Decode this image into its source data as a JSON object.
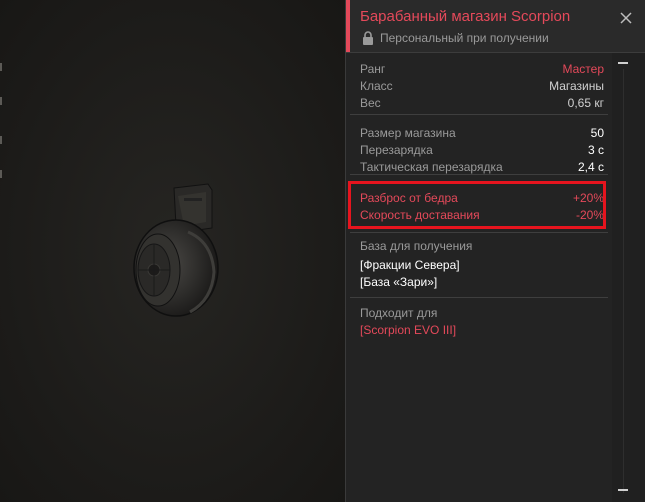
{
  "item": {
    "title": "Барабанный магазин Scorpion",
    "subtitle": "Персональный при получении"
  },
  "info": [
    {
      "label": "Ранг",
      "value": "Мастер",
      "style": "red"
    },
    {
      "label": "Класс",
      "value": "Магазины",
      "style": "normal"
    },
    {
      "label": "Вес",
      "value": "0,65 кг",
      "style": "normal"
    }
  ],
  "stats": [
    {
      "label": "Размер магазина",
      "value": "50"
    },
    {
      "label": "Перезарядка",
      "value": "3 с"
    },
    {
      "label": "Тактическая перезарядка",
      "value": "2,4 с"
    }
  ],
  "modifiers": [
    {
      "label": "Разброс от бедра",
      "value": "+20%"
    },
    {
      "label": "Скорость доставания",
      "value": "-20%"
    }
  ],
  "source": {
    "heading": "База для получения",
    "items": [
      "[Фракции Севера]",
      "[База «Зари»]"
    ]
  },
  "compat": {
    "heading": "Подходит для",
    "items": [
      "[Scorpion EVO III]"
    ]
  },
  "colors": {
    "accent": "#e4495a",
    "highlight": "#e6141e"
  },
  "icons": {
    "lock": "lock-icon",
    "close": "close-icon"
  }
}
